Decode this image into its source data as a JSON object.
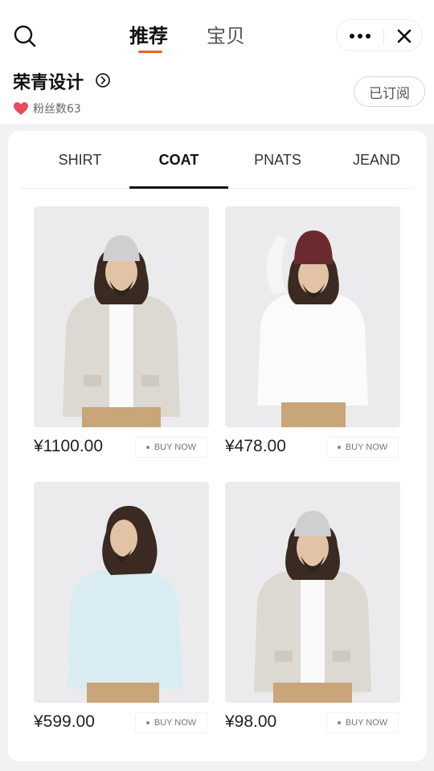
{
  "header": {
    "tabs": [
      {
        "label": "推荐",
        "active": true
      },
      {
        "label": "宝贝",
        "active": false
      }
    ],
    "icons": {
      "search": "search-icon",
      "more": "more-dots-icon",
      "close": "close-icon"
    },
    "accent_color": "#e8641e"
  },
  "shop": {
    "name": "荣青设计",
    "fans_label": "粉丝数63",
    "subscribe_label": "已订阅",
    "heart_color": "#e84a5f"
  },
  "categories": [
    {
      "label": "SHIRT",
      "active": false
    },
    {
      "label": "COAT",
      "active": true
    },
    {
      "label": "PNATS",
      "active": false
    },
    {
      "label": "JEAND",
      "active": false
    }
  ],
  "products": [
    {
      "price": "¥1100.00",
      "buy_label": "BUY NOW",
      "outfit": "beige-cardigan-grey-beanie"
    },
    {
      "price": "¥478.00",
      "buy_label": "BUY NOW",
      "outfit": "white-sweater-burgundy-beanie"
    },
    {
      "price": "¥599.00",
      "buy_label": "BUY NOW",
      "outfit": "light-blue-shirt"
    },
    {
      "price": "¥98.00",
      "buy_label": "BUY NOW",
      "outfit": "beige-cardigan-grey-beanie"
    }
  ]
}
